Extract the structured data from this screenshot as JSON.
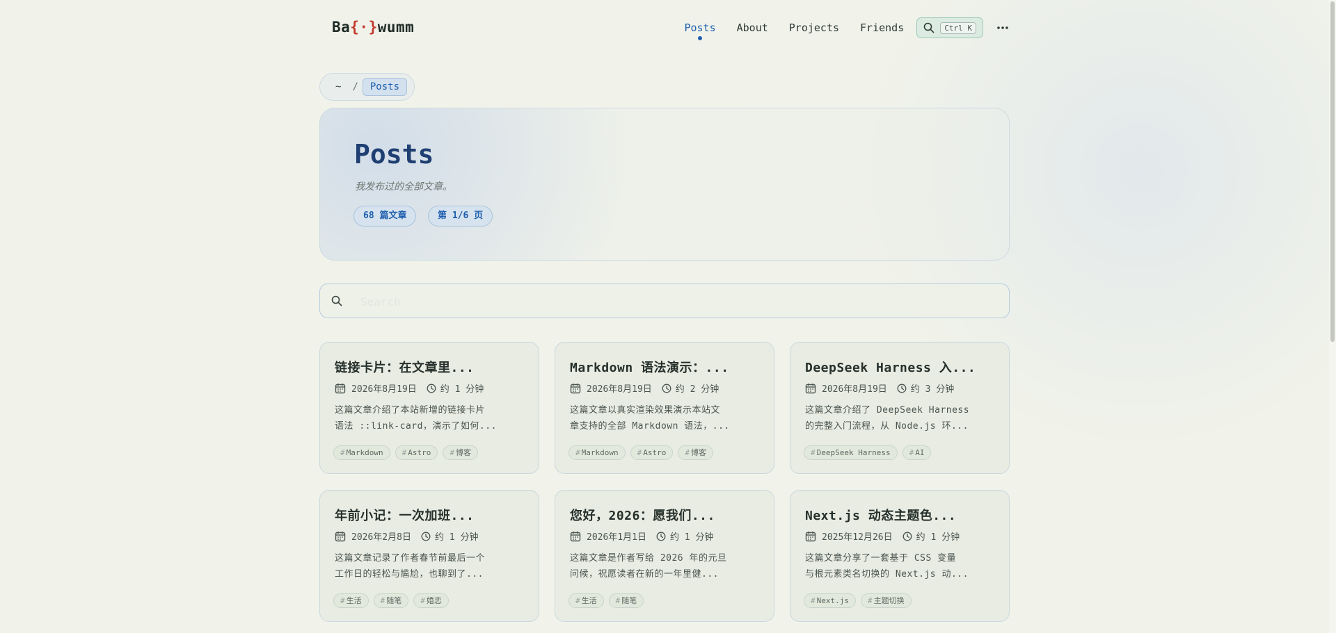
{
  "header": {
    "logo_prefix": "Ba",
    "logo_brace": "{·}",
    "logo_suffix": "wumm",
    "nav": [
      "Posts",
      "About",
      "Projects",
      "Friends"
    ],
    "active_nav": "Posts",
    "search_shortcut": "Ctrl K"
  },
  "breadcrumb": {
    "home": "~",
    "separator": "/",
    "current": "Posts"
  },
  "hero": {
    "title": "Posts",
    "subtitle": "我发布过的全部文章。",
    "count_pill": "68 篇文章",
    "page_pill": "第 1/6 页"
  },
  "search": {
    "placeholder": "Search"
  },
  "posts": [
    {
      "title": "链接卡片：在文章里...",
      "date": "2026年8月19日",
      "read": "约 1 分钟",
      "desc_1": "这篇文章介绍了本站新增的链接卡片",
      "desc_2": "语法 ::link-card，演示了如何...",
      "tags": [
        "Markdown",
        "Astro",
        "博客"
      ]
    },
    {
      "title": "Markdown 语法演示：...",
      "date": "2026年8月19日",
      "read": "约 2 分钟",
      "desc_1": "这篇文章以真实渲染效果演示本站文",
      "desc_2": "章支持的全部 Markdown 语法，...",
      "tags": [
        "Markdown",
        "Astro",
        "博客"
      ]
    },
    {
      "title": "DeepSeek Harness 入...",
      "date": "2026年8月19日",
      "read": "约 3 分钟",
      "desc_1": "这篇文章介绍了 DeepSeek Harness",
      "desc_2": "的完整入门流程，从 Node.js 环...",
      "tags": [
        "DeepSeek Harness",
        "AI"
      ]
    },
    {
      "title": "年前小记：一次加班...",
      "date": "2026年2月8日",
      "read": "约 1 分钟",
      "desc_1": "这篇文章记录了作者春节前最后一个",
      "desc_2": "工作日的轻松与尴尬，也聊到了...",
      "tags": [
        "生活",
        "随笔",
        "婚恋"
      ]
    },
    {
      "title": "您好，2026：愿我们...",
      "date": "2026年1月1日",
      "read": "约 1 分钟",
      "desc_1": "这篇文章是作者写给 2026 年的元旦",
      "desc_2": "问候，祝愿读者在新的一年里健...",
      "tags": [
        "生活",
        "随笔"
      ]
    },
    {
      "title": "Next.js 动态主题色...",
      "date": "2025年12月26日",
      "read": "约 1 分钟",
      "desc_1": "这篇文章分享了一套基于 CSS 变量",
      "desc_2": "与根元素类名切换的 Next.js 动...",
      "tags": [
        "Next.js",
        "主题切换"
      ]
    }
  ],
  "colors": {
    "accent": "#1f5fae",
    "logo_brace": "#c0392b",
    "background": "#f1f3ea"
  },
  "icons": {
    "search": "search-icon",
    "more": "more-horizontal-icon",
    "calendar": "calendar-icon",
    "clock": "clock-icon"
  }
}
